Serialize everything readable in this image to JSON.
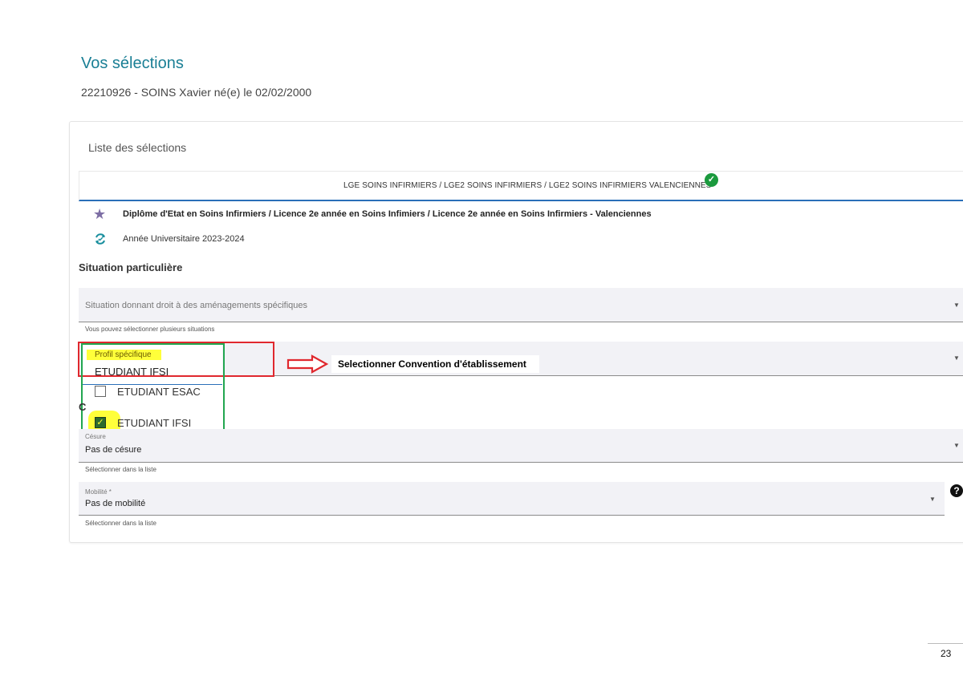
{
  "header": {
    "title": "Vos sélections",
    "student_line": "22210926 - SOINS Xavier né(e) le 02/02/2000"
  },
  "card": {
    "title": "Liste des sélections",
    "tab_label": "LGE SOINS INFIRMIERS / LGE2 SOINS INFIRMIERS / LGE2 SOINS INFIRMIERS VALENCIENNES",
    "check_badge": "✓",
    "diploma": "Diplôme d'Etat en Soins Infirmiers / Licence 2e année en Soins Infimiers / Licence 2e année en Soins Infirmiers - Valenciennes",
    "year": "Année Universitaire 2023-2024",
    "section_title": "Situation particulière"
  },
  "situation": {
    "placeholder": "Situation donnant droit à des aménagements spécifiques",
    "hint": "Vous pouvez sélectionner plusieurs situations"
  },
  "profil": {
    "label": "Profil spécifique",
    "value": "ETUDIANT IFSI",
    "options": [
      {
        "label": "ETUDIANT ESAC",
        "checked": false
      },
      {
        "label": "ETUDIANT IFSI",
        "checked": true
      }
    ]
  },
  "annotation": {
    "text": "Selectionner Convention d'établissement"
  },
  "partial_heading": "C",
  "cesure": {
    "label": "Césure",
    "value": "Pas de césure",
    "hint": "Sélectionner dans la liste"
  },
  "mobilite": {
    "label": "Mobilité *",
    "value": "Pas de mobilité",
    "hint": "Sélectionner dans la liste",
    "help": "?"
  },
  "page_number": "23",
  "colors": {
    "accent": "#1a7f95",
    "red_frame": "#e0282e",
    "green_frame": "#22a650",
    "highlight": "#ffff3a"
  },
  "icons": {
    "star": "star-icon",
    "cycle": "refresh-icon",
    "check": "check-circle-icon",
    "caret": "caret-down-icon",
    "help": "question-circle-icon",
    "arrow": "right-arrow-icon"
  }
}
